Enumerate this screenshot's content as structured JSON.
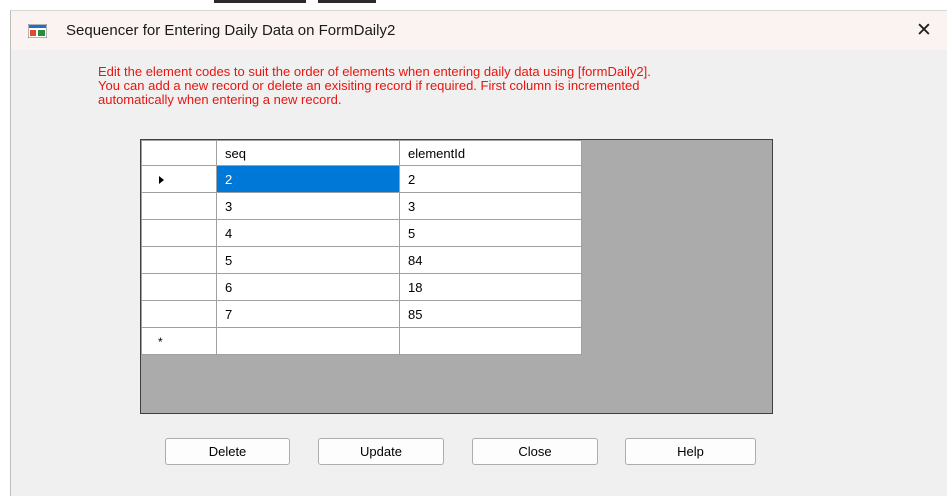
{
  "window": {
    "title": "Sequencer for Entering Daily Data on FormDaily2",
    "close_glyph": "✕"
  },
  "instructions": {
    "lines": [
      "Edit the element codes  to suit the order of elements when entering daily data using [formDaily2].",
      "You can add a new record or delete an exisiting record if required. First column is incremented",
      "automatically when entering a new record."
    ]
  },
  "grid": {
    "columns": [
      "seq",
      "elementId"
    ],
    "rows": [
      {
        "seq": "2",
        "elementId": "2"
      },
      {
        "seq": "3",
        "elementId": "3"
      },
      {
        "seq": "4",
        "elementId": "5"
      },
      {
        "seq": "5",
        "elementId": "84"
      },
      {
        "seq": "6",
        "elementId": "18"
      },
      {
        "seq": "7",
        "elementId": "85"
      }
    ],
    "new_row_marker": "*",
    "current_row_indicator": "right-triangle"
  },
  "buttons": {
    "delete": "Delete",
    "update": "Update",
    "close": "Close",
    "help": "Help"
  },
  "colors": {
    "instruction_text": "#e8150f",
    "selection": "#0078d7",
    "grid_background": "#ababab"
  }
}
